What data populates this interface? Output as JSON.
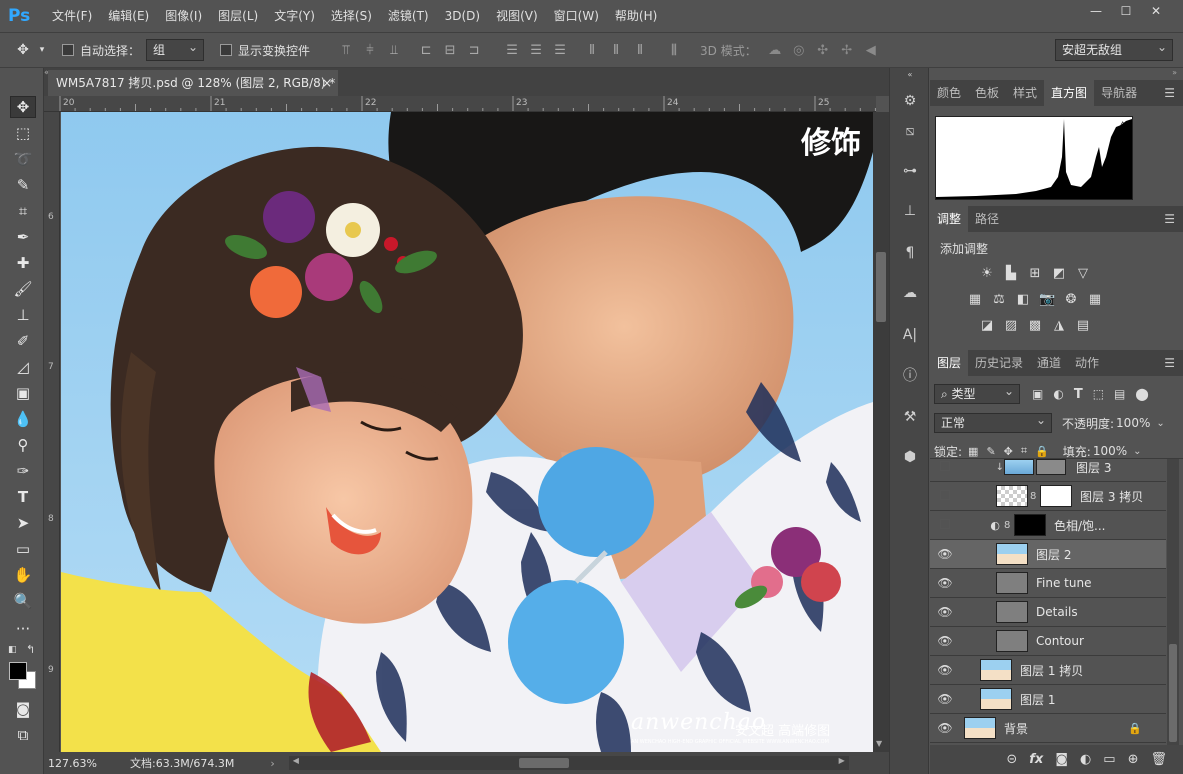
{
  "app": {
    "logo": "Ps"
  },
  "menu": [
    "文件(F)",
    "编辑(E)",
    "图像(I)",
    "图层(L)",
    "文字(Y)",
    "选择(S)",
    "滤镜(T)",
    "3D(D)",
    "视图(V)",
    "窗口(W)",
    "帮助(H)"
  ],
  "window_controls": [
    "—",
    "☐",
    "✕"
  ],
  "options": {
    "auto_select_label": "自动选择：",
    "auto_select_value": "组",
    "show_transform_label": "显示变换控件",
    "mode_3d_label": "3D 模式：",
    "workspace": "安超无敌组"
  },
  "document": {
    "tab_title": "WM5A7817 拷贝.psd @ 128% (图层 2, RGB/8) *",
    "close": "×",
    "ruler_top": [
      "20",
      "21",
      "22",
      "23",
      "24",
      "25"
    ],
    "ruler_left": [
      "6",
      "7",
      "8",
      "9"
    ],
    "watermark_title": "修饰",
    "watermark_brand": "anwenchao",
    "watermark_cn": "安文超 高端修图",
    "watermark_small": "AN WENCHAO HIGH-END GRAPHIC OFFICIAL WEBSITE WWW.ANWENCHAO.COM"
  },
  "status": {
    "zoom": "127.63%",
    "doc_info": "文档:63.3M/674.3M"
  },
  "panel_top": {
    "tabs": [
      "颜色",
      "色板",
      "样式",
      "直方图",
      "导航器"
    ],
    "active": "直方图"
  },
  "panel_adjust": {
    "tabs": [
      "调整",
      "路径"
    ],
    "title": "添加调整"
  },
  "panel_layers": {
    "tabs": [
      "图层",
      "历史记录",
      "通道",
      "动作"
    ],
    "filter_kind": "类型",
    "blend_mode": "正常",
    "opacity_label": "不透明度:",
    "opacity_value": "100%",
    "lock_label": "锁定:",
    "fill_label": "填充:",
    "fill_value": "100%",
    "layers": [
      {
        "name": "图层 3",
        "visible": false
      },
      {
        "name": "图层 3 拷贝",
        "visible": false
      },
      {
        "name": "色相/饱...",
        "visible": false
      },
      {
        "name": "图层 2",
        "visible": true,
        "selected": true
      },
      {
        "name": "Fine tune",
        "visible": true
      },
      {
        "name": "Details",
        "visible": true
      },
      {
        "name": "Contour",
        "visible": true
      },
      {
        "name": "图层 1 拷贝",
        "visible": true
      },
      {
        "name": "图层 1",
        "visible": true
      },
      {
        "name": "背景",
        "visible": true,
        "locked": true
      }
    ],
    "footer_fx": "fx"
  },
  "colors": {
    "bg": "#535353",
    "ps_blue": "#31a8ff",
    "selected_layer": "#656565"
  }
}
